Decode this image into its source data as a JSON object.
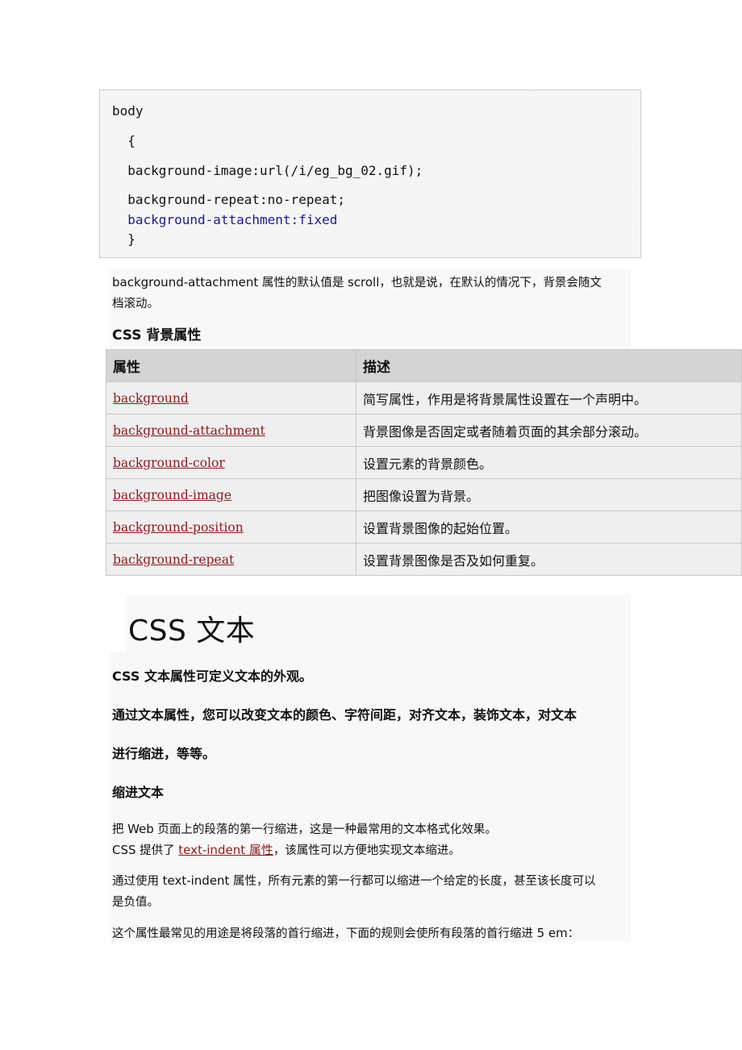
{
  "code_block": {
    "lines": [
      "body",
      "  {",
      "  background-image:url(/i/eg_bg_02.gif);",
      "  background-repeat:no-repeat;",
      "  background-attachment:fixed",
      "  }"
    ]
  },
  "intro_paragraph": {
    "line1_prefix": "background-attachment",
    "line1_mid": " 属性的默认值是 ",
    "line1_value": "scroll",
    "line1_suffix": "，也就是说，在默认的情况下，背景会随文",
    "line2": "档滚动。"
  },
  "bg_section_heading": "CSS  背景属性",
  "bg_table": {
    "headers": [
      "属性",
      "描述"
    ],
    "rows": [
      {
        "property": "background",
        "description": "简写属性，作用是将背景属性设置在一个声明中。"
      },
      {
        "property": "background-attachment",
        "description": "背景图像是否固定或者随着页面的其余部分滚动。"
      },
      {
        "property": "background-color",
        "description": "设置元素的背景颜色。"
      },
      {
        "property": "background-image",
        "description": "把图像设置为背景。"
      },
      {
        "property": "background-position",
        "description": "设置背景图像的起始位置。"
      },
      {
        "property": "background-repeat",
        "description": "设置背景图像是否及如何重复。"
      }
    ]
  },
  "text_section": {
    "title": "CSS  文本",
    "lead1": "CSS  文本属性可定义文本的外观。",
    "lead2_line1": "通过文本属性，您可以改变文本的颜色、字符间距，对齐文本，装饰文本，对文本",
    "lead2_line2": "进行缩进，等等。",
    "subheading": "缩进文本",
    "p1_line1_a": "把 ",
    "p1_line1_b": "Web",
    "p1_line1_c": " 页面上的段落的第一行缩进，这是一种最常用的文本格式化效果。",
    "p1_line2_a": "CSS",
    "p1_line2_b": " 提供了 ",
    "p1_link": "text-indent  属性",
    "p1_line2_c": "，该属性可以方便地实现文本缩进。",
    "p2_line1_a": "通过使用 ",
    "p2_line1_b": "text-indent",
    "p2_line1_c": " 属性，所有元素的第一行都可以缩进一个给定的长度，甚至该长度可以",
    "p2_line2": "是负值。",
    "p3_a": "这个属性最常见的用途是将段落的首行缩进，下面的规则会使所有段落的首行缩进 ",
    "p3_b": "5 em",
    "p3_c": "："
  },
  "colors": {
    "link": "#8b1a1a",
    "code_highlight": "#1a1a8c",
    "table_header_bg": "#d4d4d4",
    "table_row_bg": "#efefef"
  }
}
